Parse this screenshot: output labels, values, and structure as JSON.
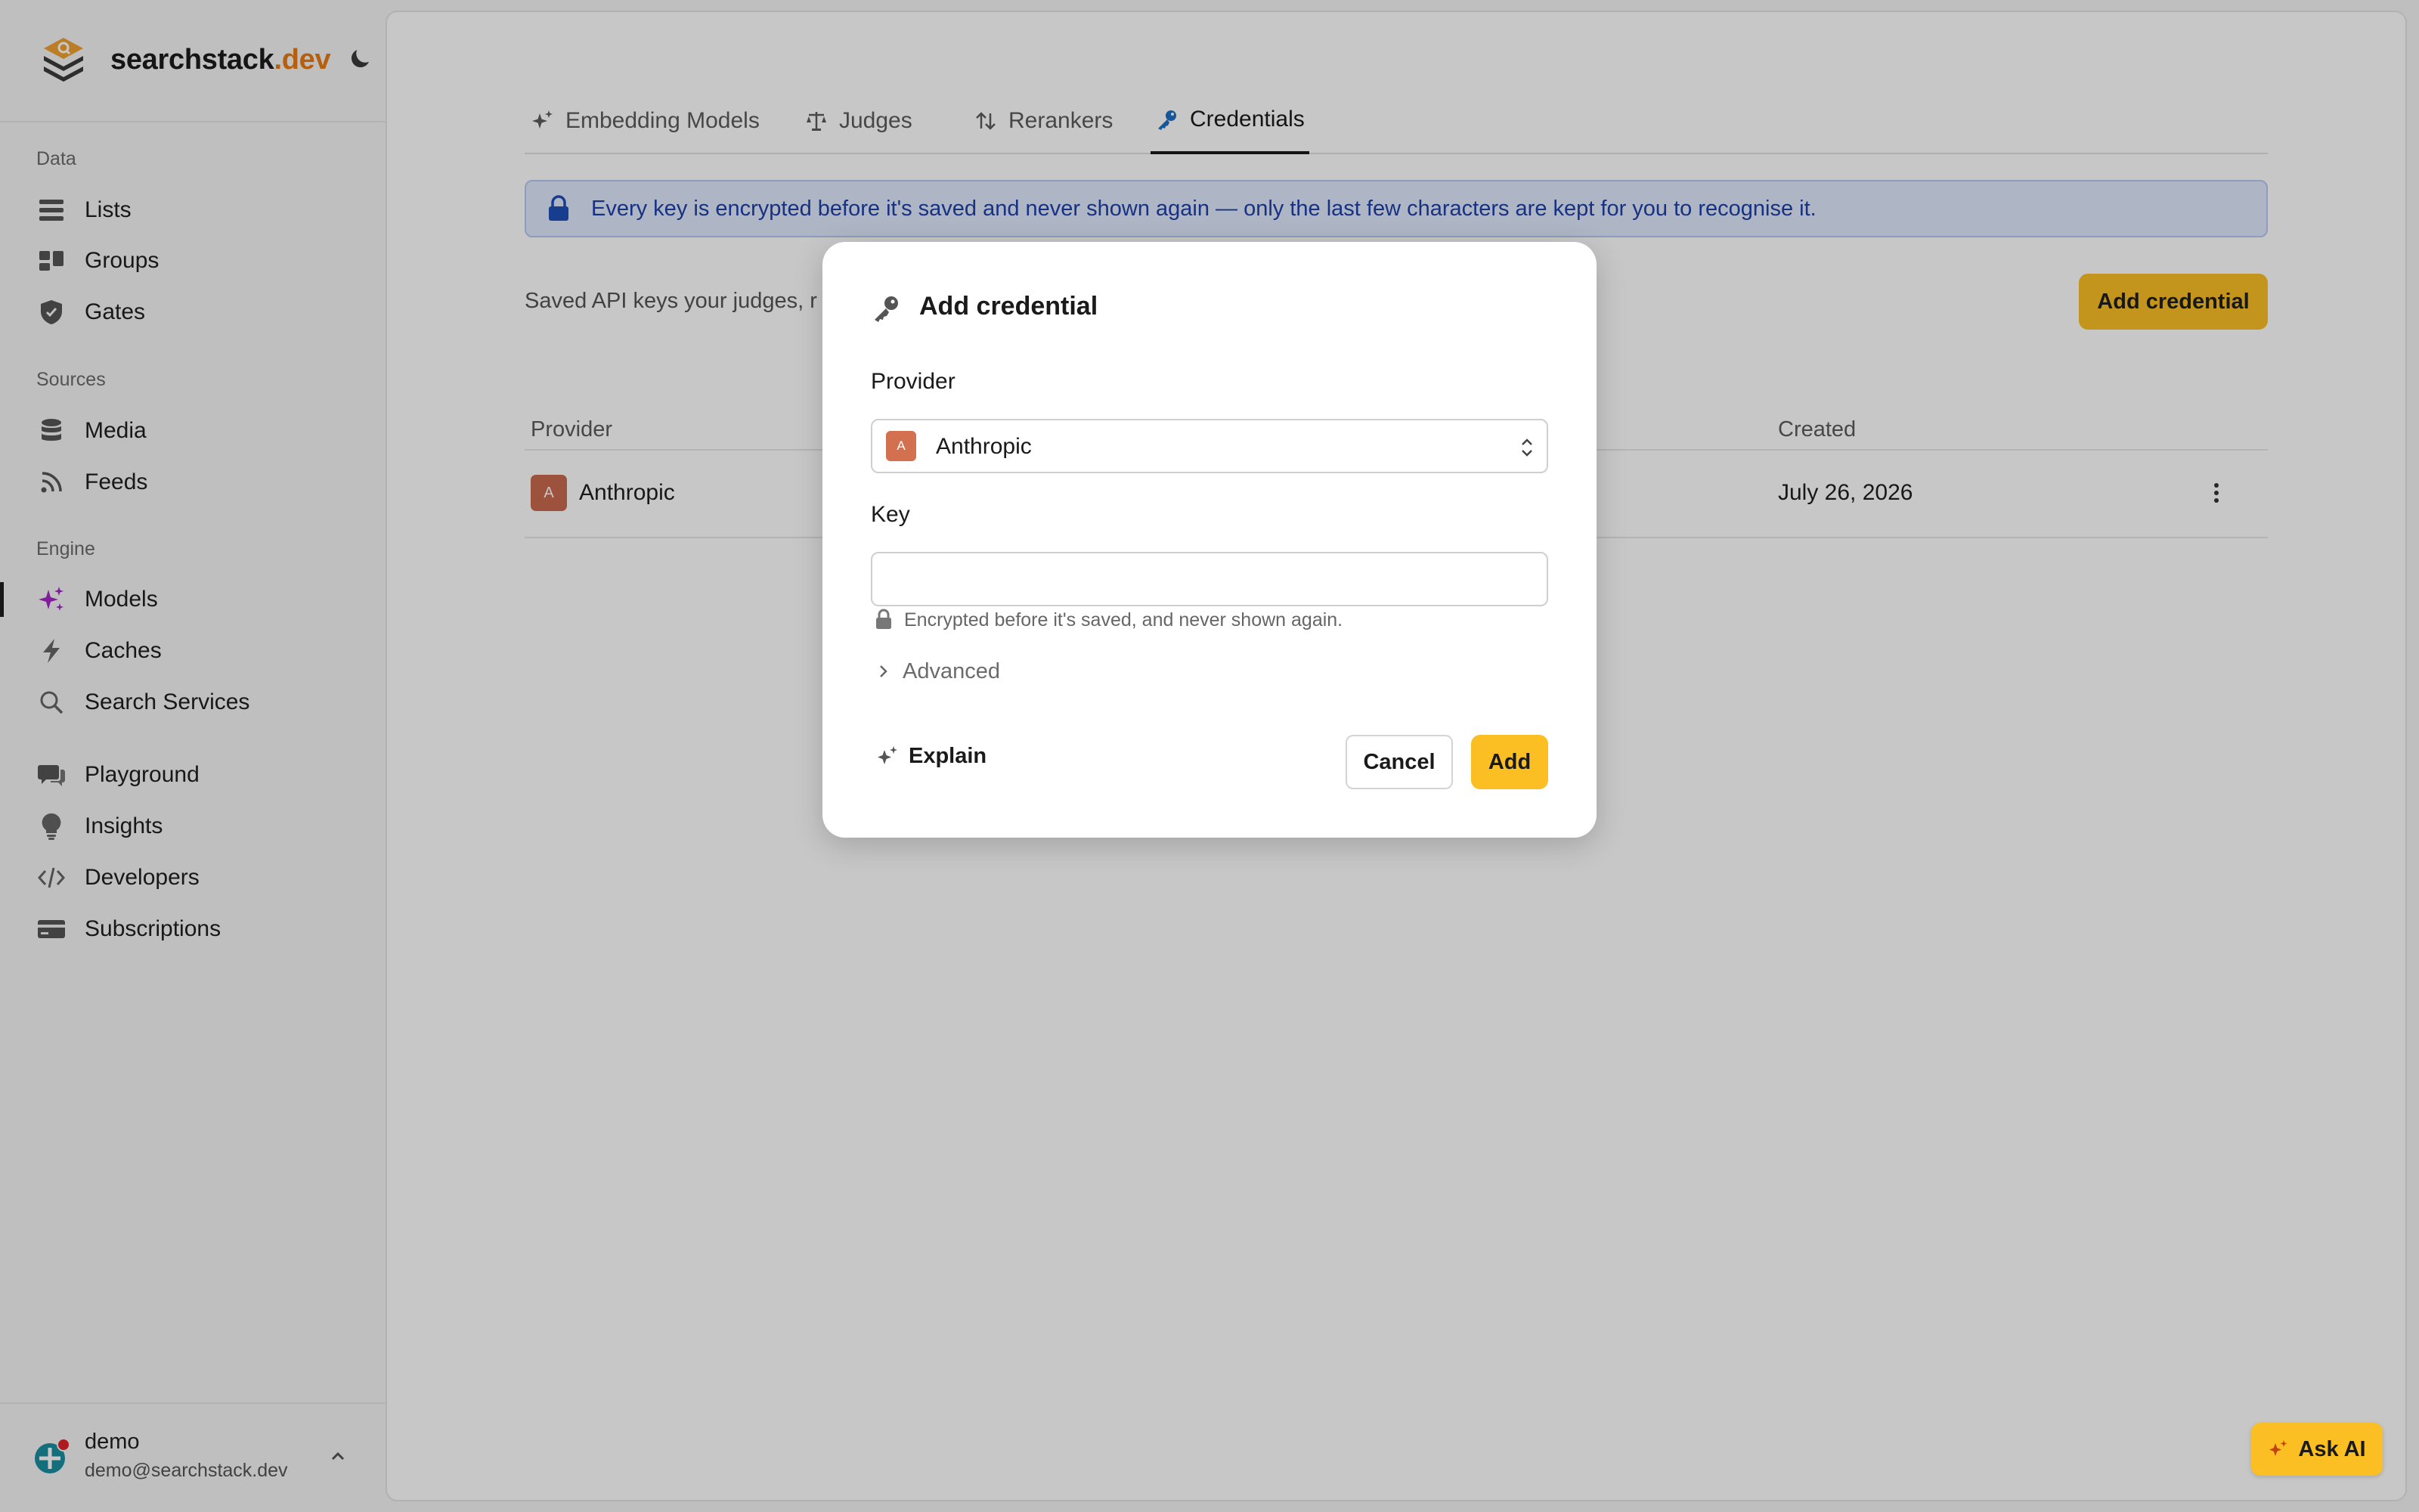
{
  "brand": {
    "name": "searchstack",
    "tld": ".dev"
  },
  "sidebar": {
    "sections": [
      {
        "label": "Data",
        "items": [
          {
            "label": "Lists",
            "icon": "list-icon"
          },
          {
            "label": "Groups",
            "icon": "groups-icon"
          },
          {
            "label": "Gates",
            "icon": "shield-icon"
          }
        ]
      },
      {
        "label": "Sources",
        "items": [
          {
            "label": "Media",
            "icon": "database-icon"
          },
          {
            "label": "Feeds",
            "icon": "rss-icon"
          }
        ]
      },
      {
        "label": "Engine",
        "items": [
          {
            "label": "Models",
            "icon": "sparkles-icon",
            "active": true
          },
          {
            "label": "Caches",
            "icon": "lightning-icon"
          },
          {
            "label": "Search Services",
            "icon": "search-icon"
          }
        ]
      },
      {
        "label": "",
        "items": [
          {
            "label": "Playground",
            "icon": "chat-icon"
          },
          {
            "label": "Insights",
            "icon": "lightbulb-icon"
          },
          {
            "label": "Developers",
            "icon": "code-icon"
          },
          {
            "label": "Subscriptions",
            "icon": "card-icon"
          }
        ]
      }
    ]
  },
  "user": {
    "name": "demo",
    "email": "demo@searchstack.dev"
  },
  "tabs": [
    {
      "label": "Embedding Models",
      "icon": "sparkles-icon"
    },
    {
      "label": "Judges",
      "icon": "scale-icon"
    },
    {
      "label": "Rerankers",
      "icon": "sort-arrows-icon"
    },
    {
      "label": "Credentials",
      "icon": "key-icon",
      "active": true
    }
  ],
  "notice": {
    "text": "Every key is encrypted before it's saved and never shown again — only the last few characters are kept for you to recognise it."
  },
  "page": {
    "intro": "Saved API keys your judges, r",
    "add_credential_label": "Add credential"
  },
  "table": {
    "columns": [
      "Provider",
      "Created"
    ],
    "rows": [
      {
        "provider": "Anthropic",
        "badge": "A",
        "created": "July 26, 2026"
      }
    ]
  },
  "modal": {
    "title": "Add credential",
    "provider_label": "Provider",
    "provider_value": "Anthropic",
    "provider_badge": "A",
    "key_label": "Key",
    "key_value": "",
    "key_hint": "Encrypted before it's saved, and never shown again.",
    "advanced_label": "Advanced",
    "explain_label": "Explain",
    "cancel_label": "Cancel",
    "add_label": "Add"
  },
  "ask_ai": {
    "label": "Ask AI"
  },
  "colors": {
    "accent": "#fbbf24",
    "brand_tld": "#ea7a12",
    "notice_bg": "#dfe8fb",
    "notice_text": "#1e3fa8",
    "anthropic_badge": "#c96a4f"
  }
}
